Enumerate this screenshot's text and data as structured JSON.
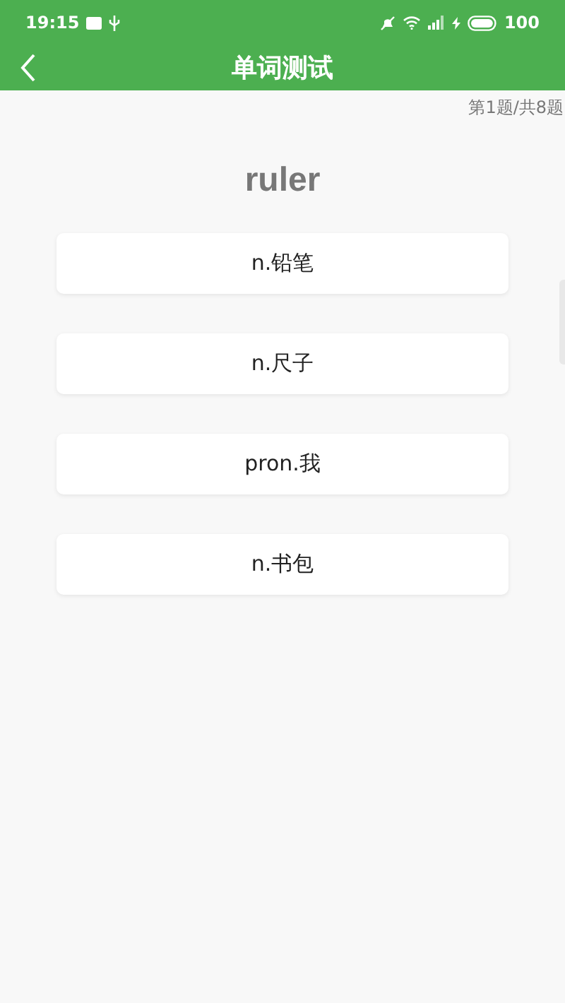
{
  "status_bar": {
    "time": "19:15",
    "battery": "100"
  },
  "header": {
    "title": "单词测试"
  },
  "progress": "第1题/共8题",
  "word": "ruler",
  "options": [
    {
      "label": "n.铅笔"
    },
    {
      "label": "n.尺子"
    },
    {
      "label": "pron.我"
    },
    {
      "label": "n.书包"
    }
  ]
}
